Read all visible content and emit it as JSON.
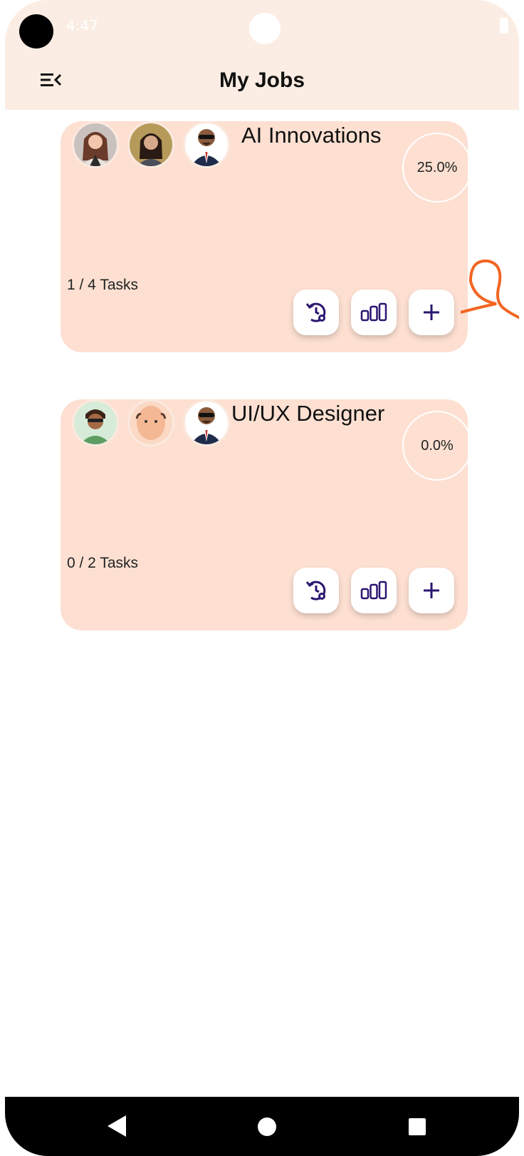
{
  "status_bar": {
    "time": "4:47"
  },
  "header": {
    "title": "My Jobs",
    "menu_icon": "menu-collapse-icon"
  },
  "jobs": [
    {
      "title": "AI Innovations",
      "progress_label": "25.0%",
      "progress": 0.25,
      "tasks_label": "1 / 4 Tasks",
      "avatars": [
        "woman-avatar-1",
        "woman-avatar-2",
        "man-suit-avatar"
      ],
      "actions": [
        "history-settings-icon",
        "bar-chart-icon",
        "plus-icon"
      ]
    },
    {
      "title": "UI/UX Designer",
      "progress_label": "0.0%",
      "progress": 0.0,
      "tasks_label": "0 / 2 Tasks",
      "avatars": [
        "man-glasses-avatar",
        "bald-man-avatar",
        "man-suit-avatar"
      ],
      "actions": [
        "history-settings-icon",
        "bar-chart-icon",
        "plus-icon"
      ]
    }
  ],
  "colors": {
    "header_bg": "#fbede3",
    "card_bg": "#fde0d2",
    "icon_color": "#2a1670",
    "annotation": "#f26522"
  },
  "nav": [
    "back-icon",
    "home-icon",
    "recents-icon"
  ]
}
